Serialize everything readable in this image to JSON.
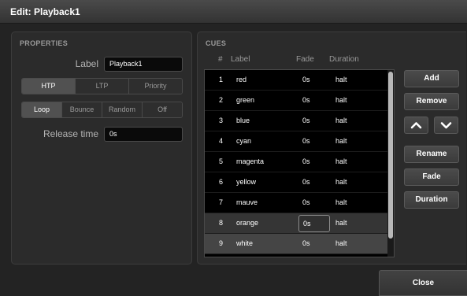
{
  "window": {
    "title": "Edit: Playback1"
  },
  "properties": {
    "section_title": "PROPERTIES",
    "label_caption": "Label",
    "label_value": "Playback1",
    "mode_options": [
      {
        "label": "HTP",
        "active": true
      },
      {
        "label": "LTP",
        "active": false
      },
      {
        "label": "Priority",
        "active": false
      }
    ],
    "loop_options": [
      {
        "label": "Loop",
        "active": true
      },
      {
        "label": "Bounce",
        "active": false
      },
      {
        "label": "Random",
        "active": false
      },
      {
        "label": "Off",
        "active": false
      }
    ],
    "release_caption": "Release time",
    "release_value": "0s"
  },
  "cues": {
    "section_title": "CUES",
    "headers": {
      "num": "#",
      "label": "Label",
      "fade": "Fade",
      "duration": "Duration"
    },
    "rows": [
      {
        "num": "1",
        "label": "red",
        "fade": "0s",
        "duration": "halt",
        "state": "dark"
      },
      {
        "num": "2",
        "label": "green",
        "fade": "0s",
        "duration": "halt",
        "state": "dark"
      },
      {
        "num": "3",
        "label": "blue",
        "fade": "0s",
        "duration": "halt",
        "state": "dark"
      },
      {
        "num": "4",
        "label": "cyan",
        "fade": "0s",
        "duration": "halt",
        "state": "dark"
      },
      {
        "num": "5",
        "label": "magenta",
        "fade": "0s",
        "duration": "halt",
        "state": "dark"
      },
      {
        "num": "6",
        "label": "yellow",
        "fade": "0s",
        "duration": "halt",
        "state": "dark"
      },
      {
        "num": "7",
        "label": "mauve",
        "fade": "0s",
        "duration": "halt",
        "state": "dark"
      },
      {
        "num": "8",
        "label": "orange",
        "fade": "0s",
        "duration": "halt",
        "state": "light",
        "editing": true
      },
      {
        "num": "9",
        "label": "white",
        "fade": "0s",
        "duration": "halt",
        "state": "lighter"
      }
    ],
    "buttons": {
      "add": "Add",
      "remove": "Remove",
      "up_icon": "chevron-up-icon",
      "down_icon": "chevron-down-icon",
      "rename": "Rename",
      "fade": "Fade",
      "duration": "Duration"
    }
  },
  "footer": {
    "close_label": "Close"
  }
}
